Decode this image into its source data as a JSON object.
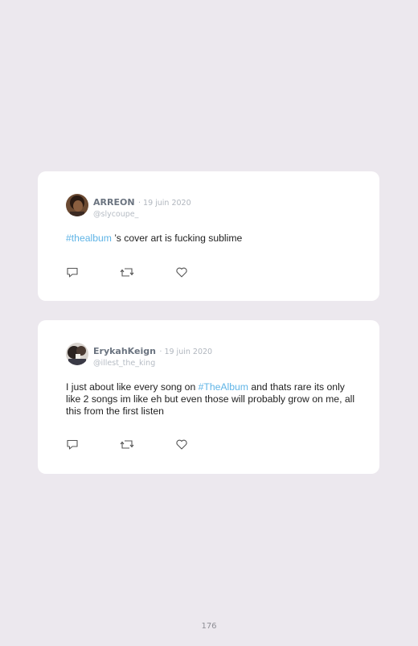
{
  "tweets": [
    {
      "name": "ARREON",
      "date": "· 19 juin 2020",
      "handle": "@slycoupe_",
      "text_parts": [
        {
          "text": "#thealbum",
          "hashtag": true
        },
        {
          "text": " ’s cover art is fucking sublime",
          "hashtag": false
        }
      ],
      "actions": [
        "reply-icon",
        "retweet-icon",
        "like-icon"
      ]
    },
    {
      "name": "ErykahKeign",
      "date": "· 19 juin 2020",
      "handle": "@illest_the_king",
      "text_parts": [
        {
          "text": "I just about like every song on ",
          "hashtag": false
        },
        {
          "text": "#TheAlbum",
          "hashtag": true
        },
        {
          "text": " and thats rare its only like 2 songs im like eh but even those will probably grow on me, all this from the first listen",
          "hashtag": false
        }
      ],
      "actions": [
        "reply-icon",
        "retweet-icon",
        "like-icon"
      ]
    }
  ],
  "page_number": "176",
  "colors": {
    "background": "#ece8ee",
    "card": "#ffffff",
    "hashtag": "#5fb4e6",
    "name": "#6b7480",
    "muted": "#b0b6be"
  }
}
